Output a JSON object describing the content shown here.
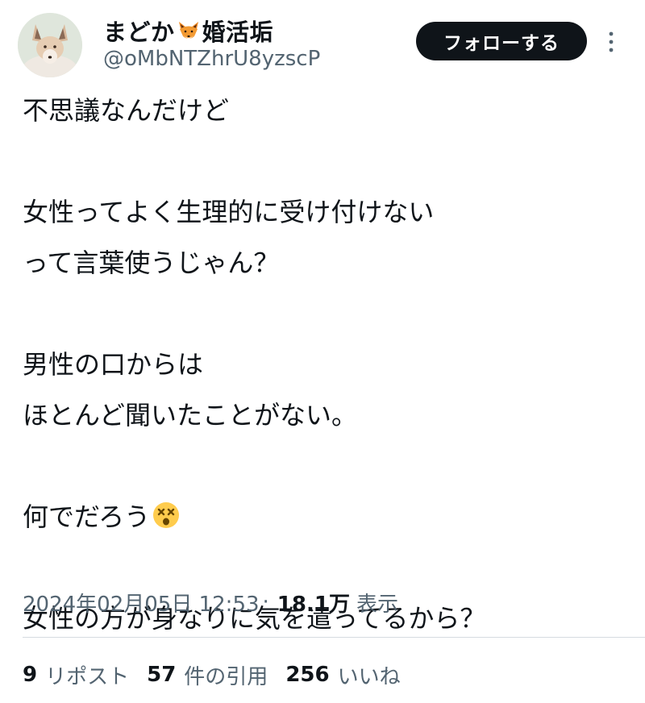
{
  "user": {
    "display_name_prefix": "まどか",
    "name_icon": "fox-face-icon",
    "display_name_suffix": "婚活垢",
    "handle": "@oMbNTZhrU8yzscP",
    "avatar_icon": "fox-avatar"
  },
  "follow_button": {
    "label": "フォローする"
  },
  "more_menu_icon": "vertical-ellipsis-icon",
  "tweet": {
    "lines": [
      "不思議なんだけど",
      "",
      "女性ってよく生理的に受け付けない",
      "って言葉使うじゃん？",
      "",
      "男性の口からは",
      "ほとんど聞いたことがない。",
      "",
      "何でだろう",
      "",
      "女性の方が身なりに気を遣ってるから？"
    ],
    "emoji_after_line_9": "dizzy-face-emoji"
  },
  "meta": {
    "timestamp": "2024年02月05日 12:53",
    "separator": "·",
    "views_count": "18.1万",
    "views_label": "表示"
  },
  "stats": {
    "reposts_count": "9",
    "reposts_label": "リポスト",
    "quotes_count": "57",
    "quotes_label": "件の引用",
    "likes_count": "256",
    "likes_label": "いいね"
  },
  "colors": {
    "text_primary": "#0f1419",
    "text_secondary": "#536471",
    "button_bg": "#0f1419",
    "button_text": "#ffffff",
    "divider": "#d6dbe0"
  }
}
